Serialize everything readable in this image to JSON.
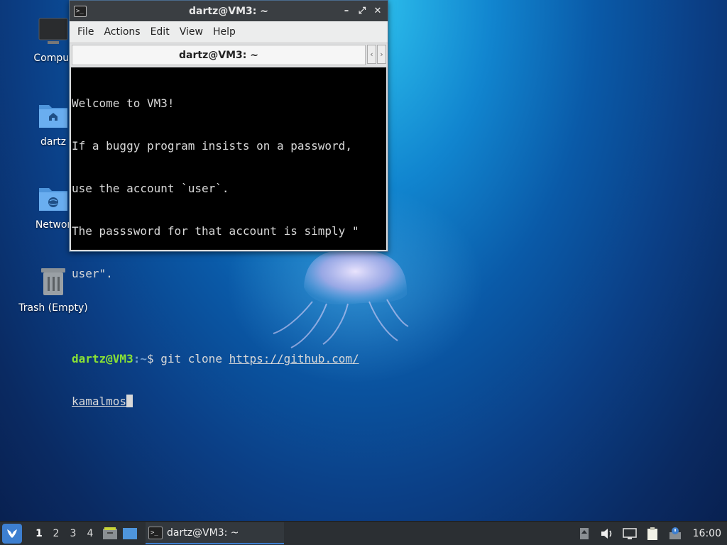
{
  "desktop": {
    "icons": [
      {
        "label": "Comput"
      },
      {
        "label": "dartz"
      },
      {
        "label": "Networ"
      },
      {
        "label": "Trash (Empty)"
      }
    ]
  },
  "window": {
    "title": "dartz@VM3: ~",
    "app_icon_glyph": ">_",
    "controls": {
      "minimize": "–",
      "maximize": "⤢",
      "close": "✕"
    },
    "menu": [
      "File",
      "Actions",
      "Edit",
      "View",
      "Help"
    ],
    "tab_label": "dartz@VM3: ~",
    "tab_nav": {
      "prev": "‹",
      "next": "›"
    }
  },
  "terminal": {
    "lines": [
      "Welcome to VM3!",
      "If a buggy program insists on a password,",
      "use the account `user`.",
      "The passsword for that account is simply \"",
      "user\".",
      ""
    ],
    "prompt_user": "dartz@VM3",
    "prompt_sep": ":",
    "prompt_path": "~",
    "prompt_dollar": "$ ",
    "command": "git clone ",
    "url_part1": "https://github.com/",
    "url_part2": "kamalmos"
  },
  "taskbar": {
    "workspaces": [
      "1",
      "2",
      "3",
      "4"
    ],
    "active_workspace": "1",
    "task_label": "dartz@VM3: ~",
    "clock": "16:00"
  },
  "colors": {
    "accent": "#3d7fd0",
    "prompt_user": "#8ae234",
    "prompt_path": "#729fcf"
  }
}
